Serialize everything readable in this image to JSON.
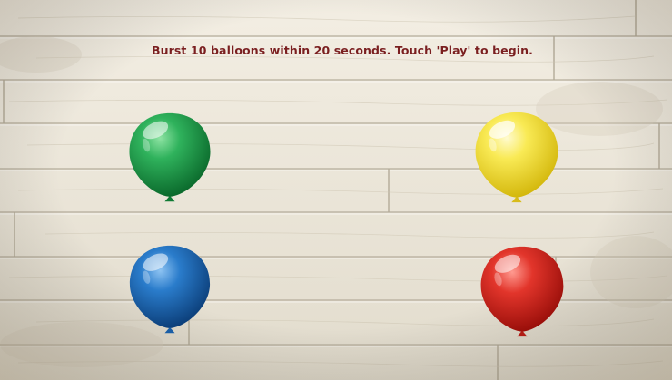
{
  "game": {
    "instruction": "Burst 10 balloons within 20 seconds. Touch 'Play' to begin."
  },
  "balloons": [
    {
      "color": "green",
      "fill": "#1f9a4a"
    },
    {
      "color": "yellow",
      "fill": "#f4e13a"
    },
    {
      "color": "blue",
      "fill": "#1c67b3"
    },
    {
      "color": "red",
      "fill": "#d8271f"
    }
  ],
  "colors": {
    "background": "#e7e1d3",
    "instruction_text": "#7a1f1f"
  }
}
